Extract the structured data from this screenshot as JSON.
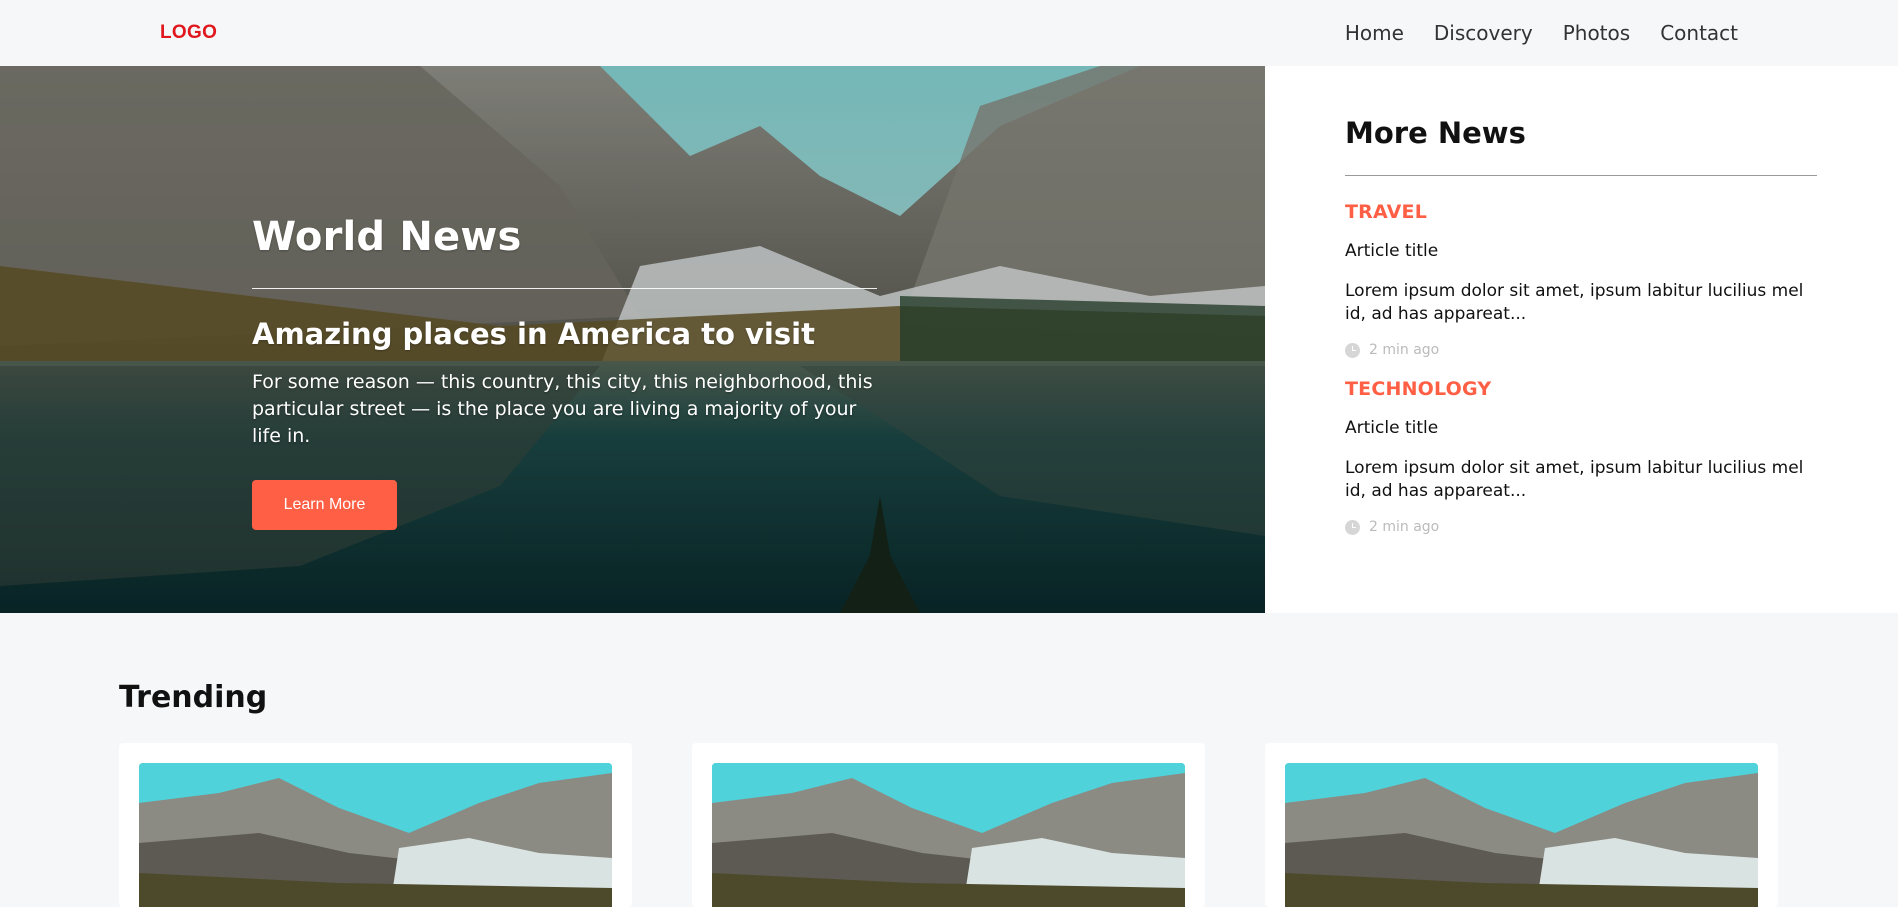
{
  "header": {
    "logo": "LOGO",
    "nav": [
      "Home",
      "Discovery",
      "Photos",
      "Contact"
    ]
  },
  "hero": {
    "kicker": "World News",
    "title": "Amazing places in America to visit",
    "text": "For some reason — this country, this city, this neighborhood, this particular street — is the place you are living a majority of your life in.",
    "button": "Learn More"
  },
  "sidebar": {
    "title": "More News",
    "items": [
      {
        "category": "TRAVEL",
        "title": "Article title",
        "excerpt": "Lorem ipsum dolor sit amet, ipsum labitur lucilius mel id, ad has appareat...",
        "time": "2 min ago"
      },
      {
        "category": "TECHNOLOGY",
        "title": "Article title",
        "excerpt": "Lorem ipsum dolor sit amet, ipsum labitur lucilius mel id, ad has appareat...",
        "time": "2 min ago"
      }
    ]
  },
  "trending": {
    "title": "Trending",
    "cards_count": 3
  },
  "colors": {
    "accent": "#ff5f45",
    "logo": "#e0181e",
    "page_bg": "#f6f7f9"
  }
}
